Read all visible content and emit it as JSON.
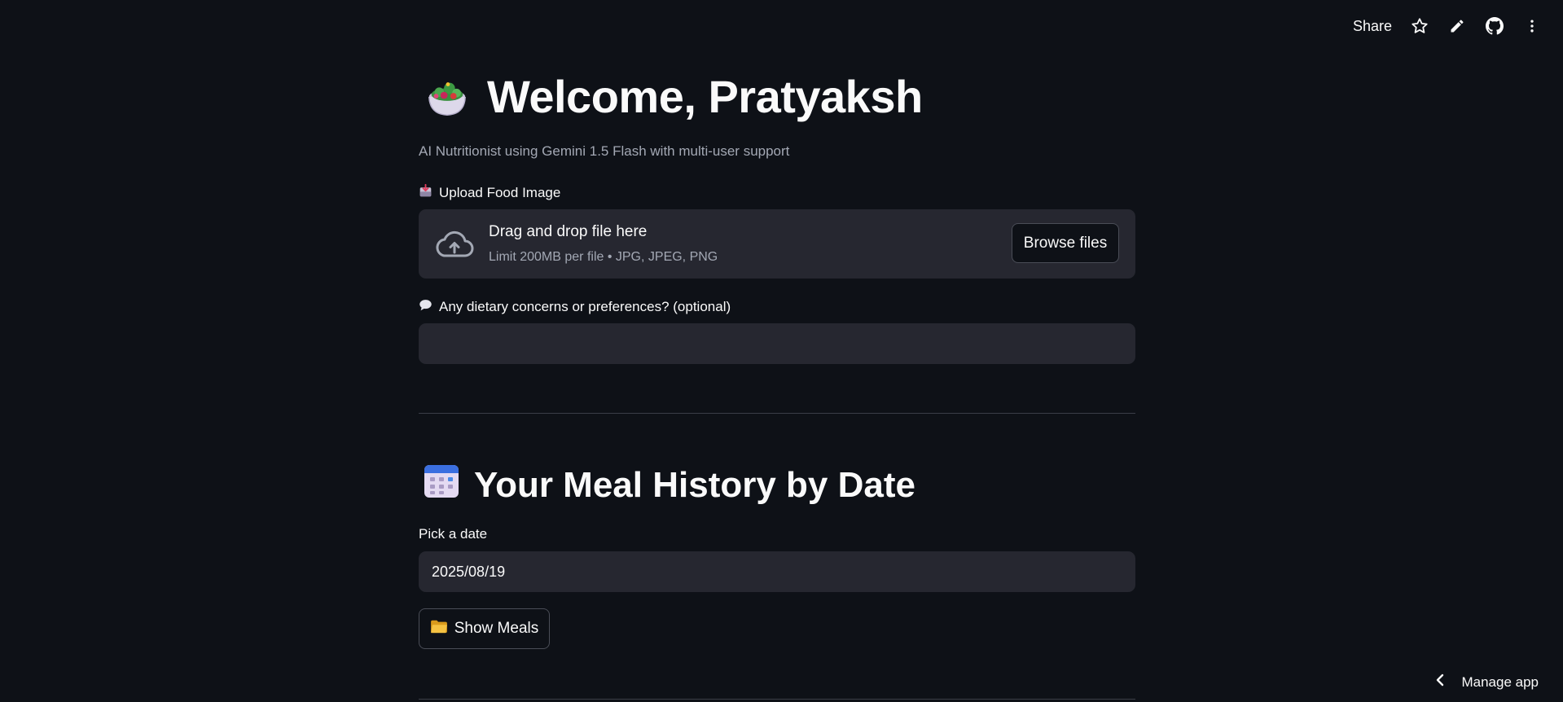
{
  "toolbar": {
    "share_label": "Share",
    "icons": [
      "star-icon",
      "pencil-icon",
      "github-icon",
      "more-vertical-icon"
    ]
  },
  "header": {
    "emoji": "salad-bowl",
    "title": "Welcome, Pratyaksh",
    "subtitle": "AI Nutritionist using Gemini 1.5 Flash with multi-user support"
  },
  "upload": {
    "label": "Upload Food Image",
    "dropzone_title": "Drag and drop file here",
    "dropzone_limit": "Limit 200MB per file • JPG, JPEG, PNG",
    "browse_label": "Browse files"
  },
  "concerns": {
    "label": "Any dietary concerns or preferences? (optional)",
    "value": "",
    "placeholder": ""
  },
  "history": {
    "emoji": "calendar",
    "title": "Your Meal History by Date",
    "date_label": "Pick a date",
    "date_value": "2025/08/19",
    "show_button_label": "Show Meals"
  },
  "footer": {
    "manage_label": "Manage app"
  },
  "colors": {
    "background": "#0e1117",
    "surface": "#262730",
    "text": "#fafafa",
    "muted": "#a3a8b4"
  }
}
